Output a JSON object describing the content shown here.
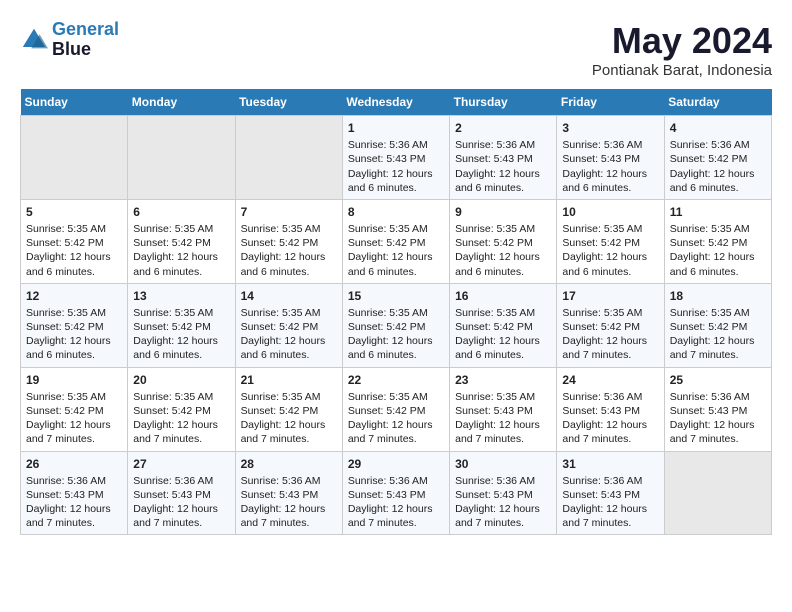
{
  "header": {
    "logo_line1": "General",
    "logo_line2": "Blue",
    "month": "May 2024",
    "location": "Pontianak Barat, Indonesia"
  },
  "days_of_week": [
    "Sunday",
    "Monday",
    "Tuesday",
    "Wednesday",
    "Thursday",
    "Friday",
    "Saturday"
  ],
  "weeks": [
    [
      {
        "day": "",
        "content": ""
      },
      {
        "day": "",
        "content": ""
      },
      {
        "day": "",
        "content": ""
      },
      {
        "day": "1",
        "content": "Sunrise: 5:36 AM\nSunset: 5:43 PM\nDaylight: 12 hours\nand 6 minutes."
      },
      {
        "day": "2",
        "content": "Sunrise: 5:36 AM\nSunset: 5:43 PM\nDaylight: 12 hours\nand 6 minutes."
      },
      {
        "day": "3",
        "content": "Sunrise: 5:36 AM\nSunset: 5:43 PM\nDaylight: 12 hours\nand 6 minutes."
      },
      {
        "day": "4",
        "content": "Sunrise: 5:36 AM\nSunset: 5:42 PM\nDaylight: 12 hours\nand 6 minutes."
      }
    ],
    [
      {
        "day": "5",
        "content": "Sunrise: 5:35 AM\nSunset: 5:42 PM\nDaylight: 12 hours\nand 6 minutes."
      },
      {
        "day": "6",
        "content": "Sunrise: 5:35 AM\nSunset: 5:42 PM\nDaylight: 12 hours\nand 6 minutes."
      },
      {
        "day": "7",
        "content": "Sunrise: 5:35 AM\nSunset: 5:42 PM\nDaylight: 12 hours\nand 6 minutes."
      },
      {
        "day": "8",
        "content": "Sunrise: 5:35 AM\nSunset: 5:42 PM\nDaylight: 12 hours\nand 6 minutes."
      },
      {
        "day": "9",
        "content": "Sunrise: 5:35 AM\nSunset: 5:42 PM\nDaylight: 12 hours\nand 6 minutes."
      },
      {
        "day": "10",
        "content": "Sunrise: 5:35 AM\nSunset: 5:42 PM\nDaylight: 12 hours\nand 6 minutes."
      },
      {
        "day": "11",
        "content": "Sunrise: 5:35 AM\nSunset: 5:42 PM\nDaylight: 12 hours\nand 6 minutes."
      }
    ],
    [
      {
        "day": "12",
        "content": "Sunrise: 5:35 AM\nSunset: 5:42 PM\nDaylight: 12 hours\nand 6 minutes."
      },
      {
        "day": "13",
        "content": "Sunrise: 5:35 AM\nSunset: 5:42 PM\nDaylight: 12 hours\nand 6 minutes."
      },
      {
        "day": "14",
        "content": "Sunrise: 5:35 AM\nSunset: 5:42 PM\nDaylight: 12 hours\nand 6 minutes."
      },
      {
        "day": "15",
        "content": "Sunrise: 5:35 AM\nSunset: 5:42 PM\nDaylight: 12 hours\nand 6 minutes."
      },
      {
        "day": "16",
        "content": "Sunrise: 5:35 AM\nSunset: 5:42 PM\nDaylight: 12 hours\nand 6 minutes."
      },
      {
        "day": "17",
        "content": "Sunrise: 5:35 AM\nSunset: 5:42 PM\nDaylight: 12 hours\nand 7 minutes."
      },
      {
        "day": "18",
        "content": "Sunrise: 5:35 AM\nSunset: 5:42 PM\nDaylight: 12 hours\nand 7 minutes."
      }
    ],
    [
      {
        "day": "19",
        "content": "Sunrise: 5:35 AM\nSunset: 5:42 PM\nDaylight: 12 hours\nand 7 minutes."
      },
      {
        "day": "20",
        "content": "Sunrise: 5:35 AM\nSunset: 5:42 PM\nDaylight: 12 hours\nand 7 minutes."
      },
      {
        "day": "21",
        "content": "Sunrise: 5:35 AM\nSunset: 5:42 PM\nDaylight: 12 hours\nand 7 minutes."
      },
      {
        "day": "22",
        "content": "Sunrise: 5:35 AM\nSunset: 5:42 PM\nDaylight: 12 hours\nand 7 minutes."
      },
      {
        "day": "23",
        "content": "Sunrise: 5:35 AM\nSunset: 5:43 PM\nDaylight: 12 hours\nand 7 minutes."
      },
      {
        "day": "24",
        "content": "Sunrise: 5:36 AM\nSunset: 5:43 PM\nDaylight: 12 hours\nand 7 minutes."
      },
      {
        "day": "25",
        "content": "Sunrise: 5:36 AM\nSunset: 5:43 PM\nDaylight: 12 hours\nand 7 minutes."
      }
    ],
    [
      {
        "day": "26",
        "content": "Sunrise: 5:36 AM\nSunset: 5:43 PM\nDaylight: 12 hours\nand 7 minutes."
      },
      {
        "day": "27",
        "content": "Sunrise: 5:36 AM\nSunset: 5:43 PM\nDaylight: 12 hours\nand 7 minutes."
      },
      {
        "day": "28",
        "content": "Sunrise: 5:36 AM\nSunset: 5:43 PM\nDaylight: 12 hours\nand 7 minutes."
      },
      {
        "day": "29",
        "content": "Sunrise: 5:36 AM\nSunset: 5:43 PM\nDaylight: 12 hours\nand 7 minutes."
      },
      {
        "day": "30",
        "content": "Sunrise: 5:36 AM\nSunset: 5:43 PM\nDaylight: 12 hours\nand 7 minutes."
      },
      {
        "day": "31",
        "content": "Sunrise: 5:36 AM\nSunset: 5:43 PM\nDaylight: 12 hours\nand 7 minutes."
      },
      {
        "day": "",
        "content": ""
      }
    ]
  ]
}
